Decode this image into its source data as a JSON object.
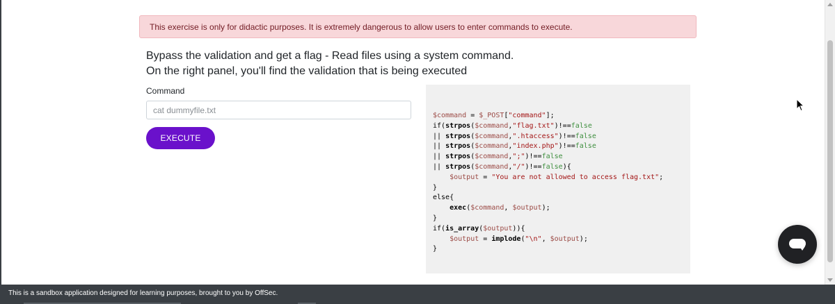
{
  "alert": {
    "text": "This exercise is only for didactic purposes. It is extremely dangerous to allow users to enter commands to execute."
  },
  "intro": {
    "line1": "Bypass the validation and get a flag - Read files using a system command.",
    "line2": "On the right panel, you'll find the validation that is being executed"
  },
  "form": {
    "label": "Command",
    "placeholder": "cat dummyfile.txt",
    "value": "",
    "button_label": "EXECUTE"
  },
  "code": {
    "lines": [
      [
        {
          "t": "$command",
          "c": "var"
        },
        {
          "t": " = ",
          "c": "kw"
        },
        {
          "t": "$_POST",
          "c": "var"
        },
        {
          "t": "[",
          "c": "kw"
        },
        {
          "t": "\"command\"",
          "c": "str"
        },
        {
          "t": "];",
          "c": "kw"
        }
      ],
      [
        {
          "t": "if(",
          "c": "kw"
        },
        {
          "t": "strpos",
          "c": "fn"
        },
        {
          "t": "(",
          "c": "kw"
        },
        {
          "t": "$command",
          "c": "var"
        },
        {
          "t": ",",
          "c": "kw"
        },
        {
          "t": "\"flag.txt\"",
          "c": "str"
        },
        {
          "t": ")!==",
          "c": "kw"
        },
        {
          "t": "false",
          "c": "bool"
        }
      ],
      [
        {
          "t": "|| ",
          "c": "kw"
        },
        {
          "t": "strpos",
          "c": "fn"
        },
        {
          "t": "(",
          "c": "kw"
        },
        {
          "t": "$command",
          "c": "var"
        },
        {
          "t": ",",
          "c": "kw"
        },
        {
          "t": "\".htaccess\"",
          "c": "str"
        },
        {
          "t": ")!==",
          "c": "kw"
        },
        {
          "t": "false",
          "c": "bool"
        }
      ],
      [
        {
          "t": "|| ",
          "c": "kw"
        },
        {
          "t": "strpos",
          "c": "fn"
        },
        {
          "t": "(",
          "c": "kw"
        },
        {
          "t": "$command",
          "c": "var"
        },
        {
          "t": ",",
          "c": "kw"
        },
        {
          "t": "\"index.php\"",
          "c": "str"
        },
        {
          "t": ")!==",
          "c": "kw"
        },
        {
          "t": "false",
          "c": "bool"
        }
      ],
      [
        {
          "t": "|| ",
          "c": "kw"
        },
        {
          "t": "strpos",
          "c": "fn"
        },
        {
          "t": "(",
          "c": "kw"
        },
        {
          "t": "$command",
          "c": "var"
        },
        {
          "t": ",",
          "c": "kw"
        },
        {
          "t": "\";\"",
          "c": "str"
        },
        {
          "t": ")!==",
          "c": "kw"
        },
        {
          "t": "false",
          "c": "bool"
        }
      ],
      [
        {
          "t": "|| ",
          "c": "kw"
        },
        {
          "t": "strpos",
          "c": "fn"
        },
        {
          "t": "(",
          "c": "kw"
        },
        {
          "t": "$command",
          "c": "var"
        },
        {
          "t": ",",
          "c": "kw"
        },
        {
          "t": "\"/\"",
          "c": "str"
        },
        {
          "t": ")!==",
          "c": "kw"
        },
        {
          "t": "false",
          "c": "bool"
        },
        {
          "t": "){",
          "c": "kw"
        }
      ],
      [
        {
          "t": "    ",
          "c": "kw"
        },
        {
          "t": "$output",
          "c": "var"
        },
        {
          "t": " = ",
          "c": "kw"
        },
        {
          "t": "\"You are not allowed to access flag.txt\"",
          "c": "str"
        },
        {
          "t": ";",
          "c": "kw"
        }
      ],
      [
        {
          "t": "}",
          "c": "kw"
        }
      ],
      [
        {
          "t": "else{",
          "c": "kw"
        }
      ],
      [
        {
          "t": "    ",
          "c": "kw"
        },
        {
          "t": "exec",
          "c": "fn"
        },
        {
          "t": "(",
          "c": "kw"
        },
        {
          "t": "$command",
          "c": "var"
        },
        {
          "t": ", ",
          "c": "kw"
        },
        {
          "t": "$output",
          "c": "var"
        },
        {
          "t": ");",
          "c": "kw"
        }
      ],
      [
        {
          "t": "}",
          "c": "kw"
        }
      ],
      [
        {
          "t": "if(",
          "c": "kw"
        },
        {
          "t": "is_array",
          "c": "fn"
        },
        {
          "t": "(",
          "c": "kw"
        },
        {
          "t": "$output",
          "c": "var"
        },
        {
          "t": ")){",
          "c": "kw"
        }
      ],
      [
        {
          "t": "    ",
          "c": "kw"
        },
        {
          "t": "$output",
          "c": "var"
        },
        {
          "t": " = ",
          "c": "kw"
        },
        {
          "t": "implode",
          "c": "fn"
        },
        {
          "t": "(",
          "c": "kw"
        },
        {
          "t": "\"\\n\"",
          "c": "str"
        },
        {
          "t": ", ",
          "c": "kw"
        },
        {
          "t": "$output",
          "c": "var"
        },
        {
          "t": ");",
          "c": "kw"
        }
      ],
      [
        {
          "t": "}",
          "c": "kw"
        }
      ]
    ]
  },
  "footer": {
    "text": "This is a sandbox application designed for learning purposes, brought to you by OffSec."
  },
  "icons": {
    "chat": "chat-bubble-icon",
    "cursor": "mouse-pointer-icon"
  },
  "colors": {
    "alert_bg": "#f8d7da",
    "accent": "#6a11cb",
    "footer_bg": "#3a3f44",
    "chat_bg": "#202124"
  }
}
